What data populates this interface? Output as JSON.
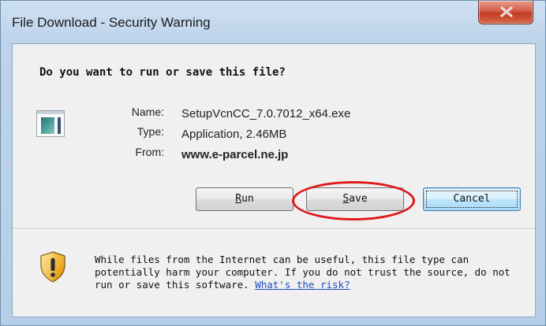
{
  "window": {
    "title": "File Download - Security Warning",
    "close_icon": "close-x-icon"
  },
  "dialog": {
    "question": "Do you want to run or save this file?",
    "file_icon": "application-window-icon",
    "fields": [
      {
        "label": "Name:",
        "value": "SetupVcnCC_7.0.7012_x64.exe"
      },
      {
        "label": "Type:",
        "value": "Application, 2.46MB"
      },
      {
        "label": "From:",
        "value": "www.e-parcel.ne.jp"
      }
    ],
    "buttons": {
      "run": {
        "first": "R",
        "rest": "un"
      },
      "save": {
        "first": "S",
        "rest": "ave"
      },
      "cancel": "Cancel"
    },
    "warning": {
      "icon": "security-shield-warning-icon",
      "text": "While files from the Internet can be useful, this file type can potentially harm your computer. If you do not trust the source, do not run or save this software. ",
      "link": "What's the risk?"
    }
  },
  "colors": {
    "annotation_circle": "#e01818",
    "link": "#1a4fc4",
    "close_button": "#c13b22"
  }
}
